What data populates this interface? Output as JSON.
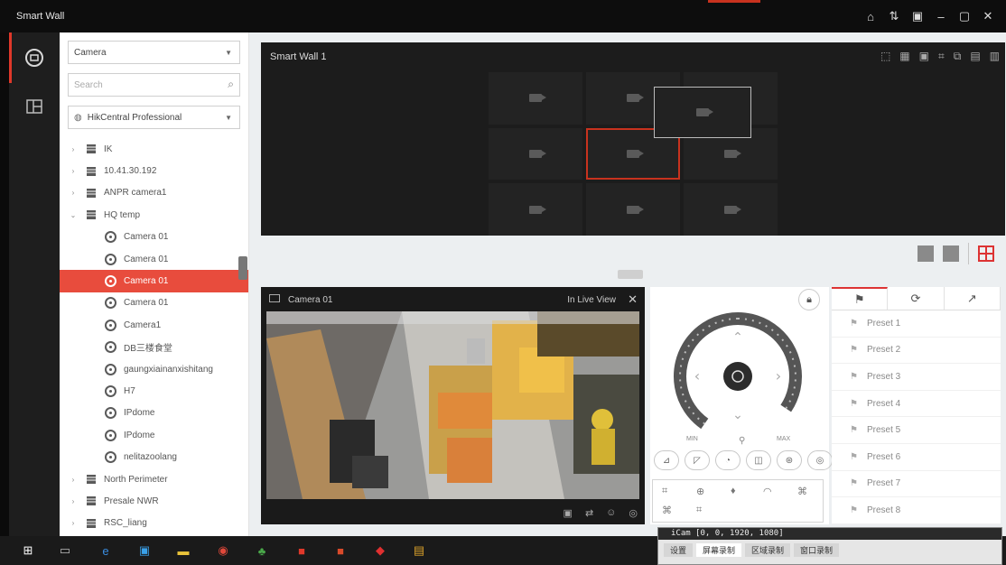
{
  "window": {
    "title": "Smart Wall",
    "controls": [
      "⌂",
      "⇅",
      "▣",
      "–",
      "▢",
      "✕"
    ]
  },
  "sidebar": {
    "source_select": "Camera",
    "search_placeholder": "Search",
    "site_select": "HikCentral Professional"
  },
  "tree": [
    {
      "type": "device",
      "label": "IK",
      "expand": "collapsed"
    },
    {
      "type": "device",
      "label": "10.41.30.192",
      "expand": "collapsed"
    },
    {
      "type": "device",
      "label": "ANPR camera1",
      "expand": "collapsed"
    },
    {
      "type": "device",
      "label": "HQ temp",
      "expand": "expanded"
    },
    {
      "type": "camera",
      "label": "Camera 01"
    },
    {
      "type": "camera",
      "label": "Camera 01"
    },
    {
      "type": "camera",
      "label": "Camera 01",
      "selected": true
    },
    {
      "type": "camera",
      "label": "Camera 01"
    },
    {
      "type": "camera",
      "label": "Camera1"
    },
    {
      "type": "camera",
      "label": "DB三楼食堂"
    },
    {
      "type": "camera",
      "label": "gaungxiainanxishitang"
    },
    {
      "type": "camera",
      "label": "H7"
    },
    {
      "type": "camera",
      "label": "IPdome"
    },
    {
      "type": "camera",
      "label": "IPdome"
    },
    {
      "type": "camera",
      "label": "nelitazoolang"
    },
    {
      "type": "device",
      "label": "North Perimeter",
      "expand": "collapsed"
    },
    {
      "type": "device",
      "label": "Presale NWR",
      "expand": "collapsed"
    },
    {
      "type": "device",
      "label": "RSC_liang",
      "expand": "collapsed"
    }
  ],
  "wall": {
    "name": "Smart Wall 1",
    "toolbar": [
      "⬚",
      "▦",
      "▣",
      "⌗",
      "⧉",
      "▤",
      "▥"
    ],
    "screens": 9,
    "selected_screen": 4
  },
  "player": {
    "camera": "Camera 01",
    "mode": "In Live View",
    "bottom_icons": [
      "▣",
      "⇄",
      "☺",
      "◎"
    ]
  },
  "ptz": {
    "speed_min": "MIN",
    "speed_max": "MAX"
  },
  "presets": [
    "Preset 1",
    "Preset 2",
    "Preset 3",
    "Preset 4",
    "Preset 5",
    "Preset 6",
    "Preset 7",
    "Preset 8"
  ],
  "taskbar": {
    "apps": [
      {
        "glyph": "⊞",
        "color": "#ffffff"
      },
      {
        "glyph": "▭",
        "color": "#bbbbbb"
      },
      {
        "glyph": "e",
        "color": "#3a8de0"
      },
      {
        "glyph": "▣",
        "color": "#3aa0e8"
      },
      {
        "glyph": "▬",
        "color": "#e8c23a"
      },
      {
        "glyph": "◉",
        "color": "#e0483a"
      },
      {
        "glyph": "♣",
        "color": "#4aa84a"
      },
      {
        "glyph": "■",
        "color": "#e0382a"
      },
      {
        "glyph": "■",
        "color": "#d94a2a"
      },
      {
        "glyph": "◆",
        "color": "#e03030"
      },
      {
        "glyph": "▤",
        "color": "#d9a02a"
      }
    ],
    "popup_title": "iCam [0, 0, 1920, 1080]",
    "popup_tabs": [
      "设置",
      "屏幕录制",
      "区域录制",
      "窗口录制"
    ]
  }
}
